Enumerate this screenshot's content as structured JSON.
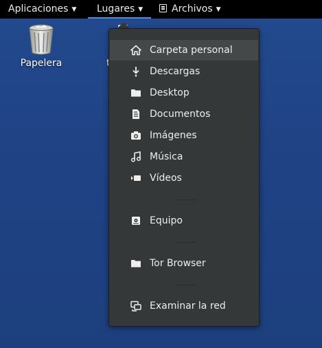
{
  "topbar": {
    "applications": "Aplicaciones",
    "places": "Lugares",
    "files": "Archivos",
    "arrow": "▼"
  },
  "desktop": {
    "trash_label": "Papelera",
    "partial_label": "t"
  },
  "places_menu": {
    "items": [
      {
        "label": "Carpeta personal",
        "icon": "home-icon"
      },
      {
        "label": "Descargas",
        "icon": "download-icon"
      },
      {
        "label": "Desktop",
        "icon": "folder-icon"
      },
      {
        "label": "Documentos",
        "icon": "document-icon"
      },
      {
        "label": "Imágenes",
        "icon": "camera-icon"
      },
      {
        "label": "Música",
        "icon": "music-icon"
      },
      {
        "label": "Vídeos",
        "icon": "video-icon"
      },
      {
        "label": "Equipo",
        "icon": "drive-icon"
      },
      {
        "label": "Tor Browser",
        "icon": "folder-icon"
      },
      {
        "label": "Examinar la red",
        "icon": "network-icon"
      }
    ]
  },
  "colors": {
    "desktop_bg": "#1f4385",
    "topbar_bg": "#000000",
    "menu_bg": "#353839",
    "menu_hover": "#444849",
    "accent": "#4a90d9"
  }
}
